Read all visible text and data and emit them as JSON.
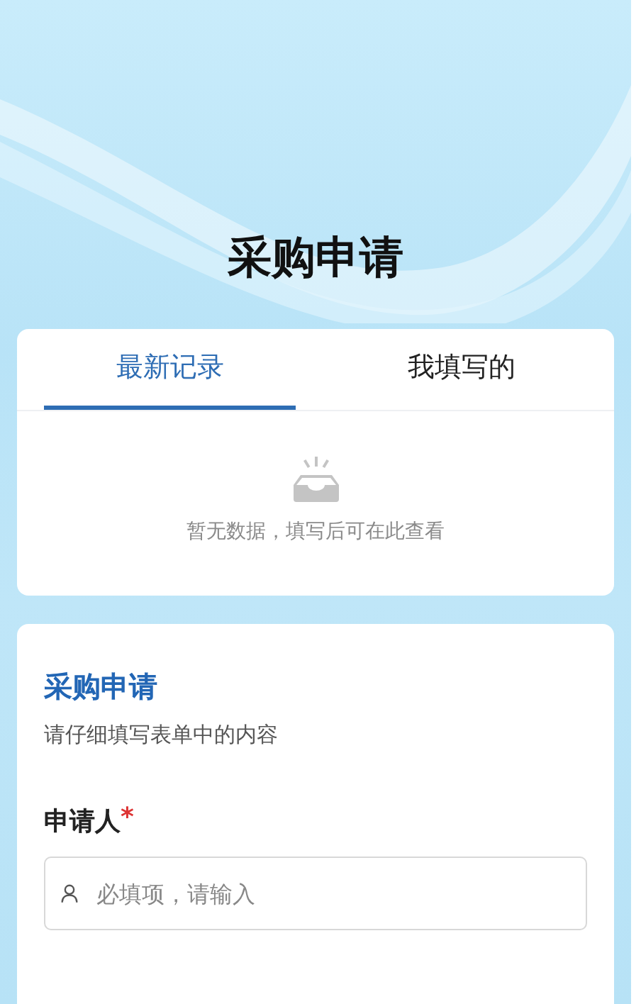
{
  "header": {
    "title": "采购申请"
  },
  "records": {
    "tabs": [
      {
        "label": "最新记录",
        "selected": true
      },
      {
        "label": "我填写的",
        "selected": false
      }
    ],
    "empty_text": "暂无数据，填写后可在此查看"
  },
  "form": {
    "title": "采购申请",
    "description": "请仔细填写表单中的内容",
    "fields": [
      {
        "label": "申请人",
        "required_mark": "*",
        "placeholder": "必填项，请输入"
      }
    ]
  }
}
